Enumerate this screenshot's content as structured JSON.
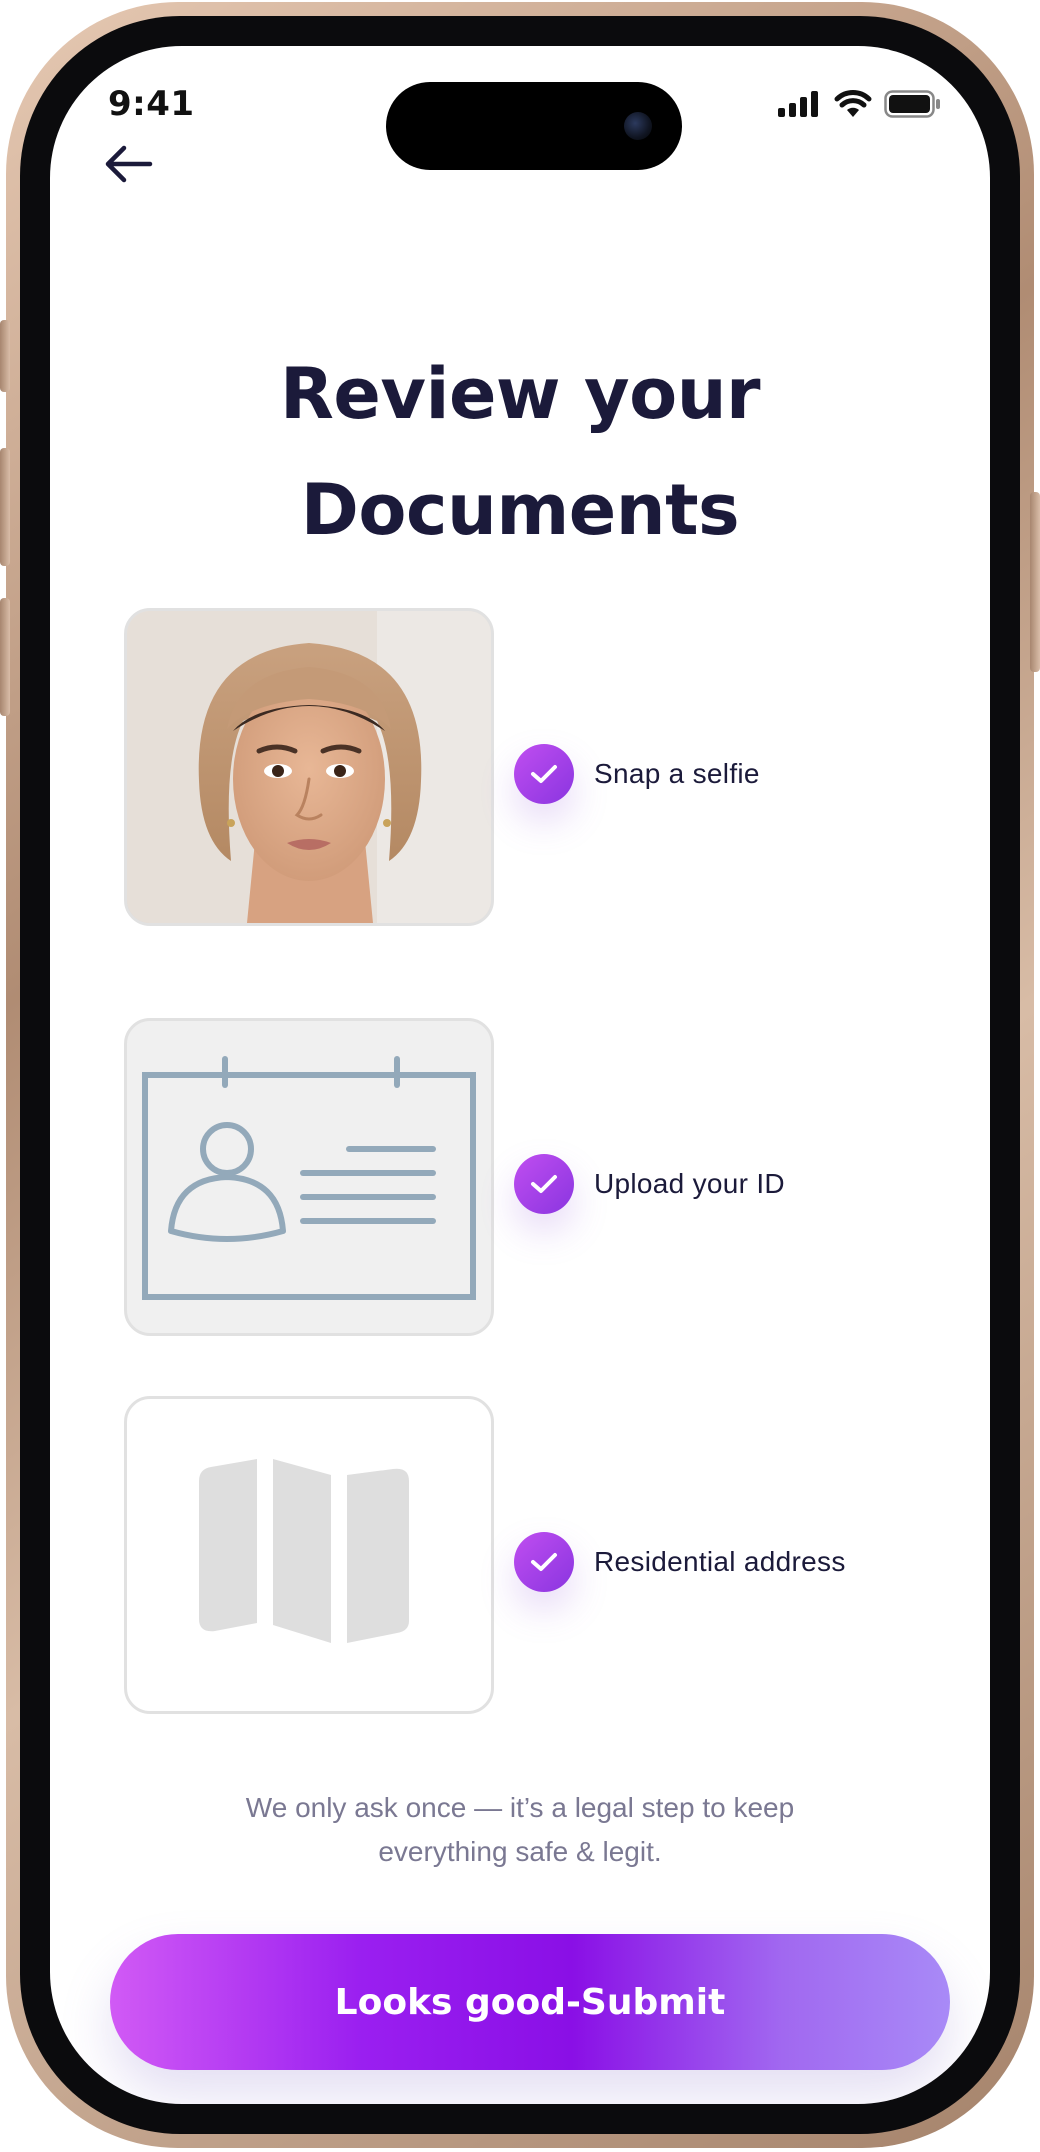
{
  "status_bar": {
    "time": "9:41",
    "icons": [
      "cellular-signal-icon",
      "wifi-icon",
      "battery-icon"
    ]
  },
  "nav": {
    "back_icon": "arrow-left-icon"
  },
  "page": {
    "title_line1": "Review your",
    "title_line2": "Documents"
  },
  "documents": [
    {
      "label": "Snap a selfie",
      "status": "complete",
      "thumbnail": "selfie-photo"
    },
    {
      "label": "Upload your ID",
      "status": "complete",
      "thumbnail": "id-card-icon"
    },
    {
      "label": "Residential address",
      "status": "complete",
      "thumbnail": "map-icon"
    }
  ],
  "note": {
    "line1": "We only ask once — it’s a legal step to keep",
    "line2": "everything safe & legit."
  },
  "submit": {
    "label": "Looks good-Submit"
  },
  "colors": {
    "title": "#1b1a3a",
    "check_start": "#c04ef0",
    "check_end": "#8a35e0",
    "button_start": "#d15af5",
    "button_mid": "#8a0fe6",
    "button_end": "#a88af7",
    "note_text": "#7a7892"
  }
}
